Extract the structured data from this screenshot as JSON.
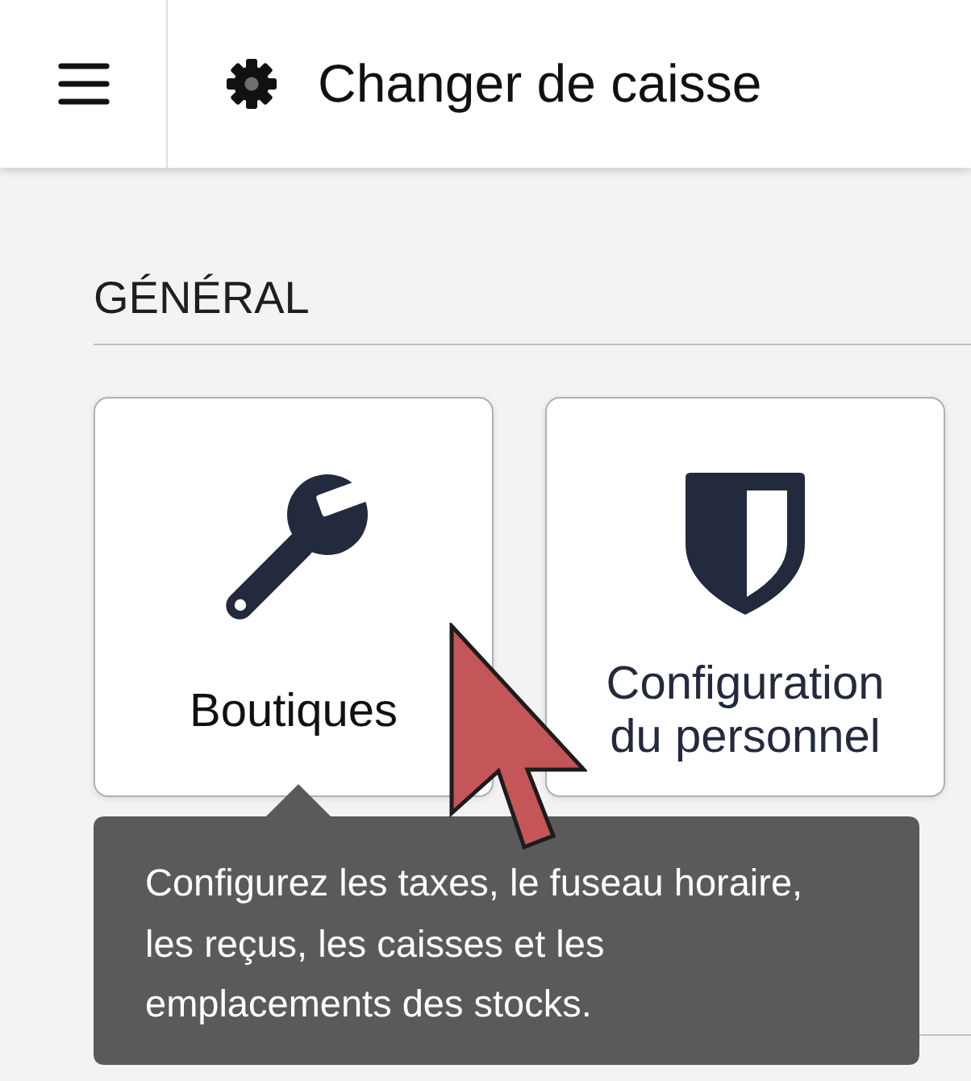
{
  "header": {
    "title": "Changer de caisse"
  },
  "sections": [
    {
      "heading": "GÉNÉRAL",
      "cards": [
        {
          "label": "Boutiques",
          "hovered": true,
          "tooltip": "Configurez les taxes, le fuseau horaire, les reçus, les caisses et les emplacements des stocks."
        },
        {
          "label": "Configuration du personnel",
          "hovered": false
        }
      ]
    }
  ]
}
